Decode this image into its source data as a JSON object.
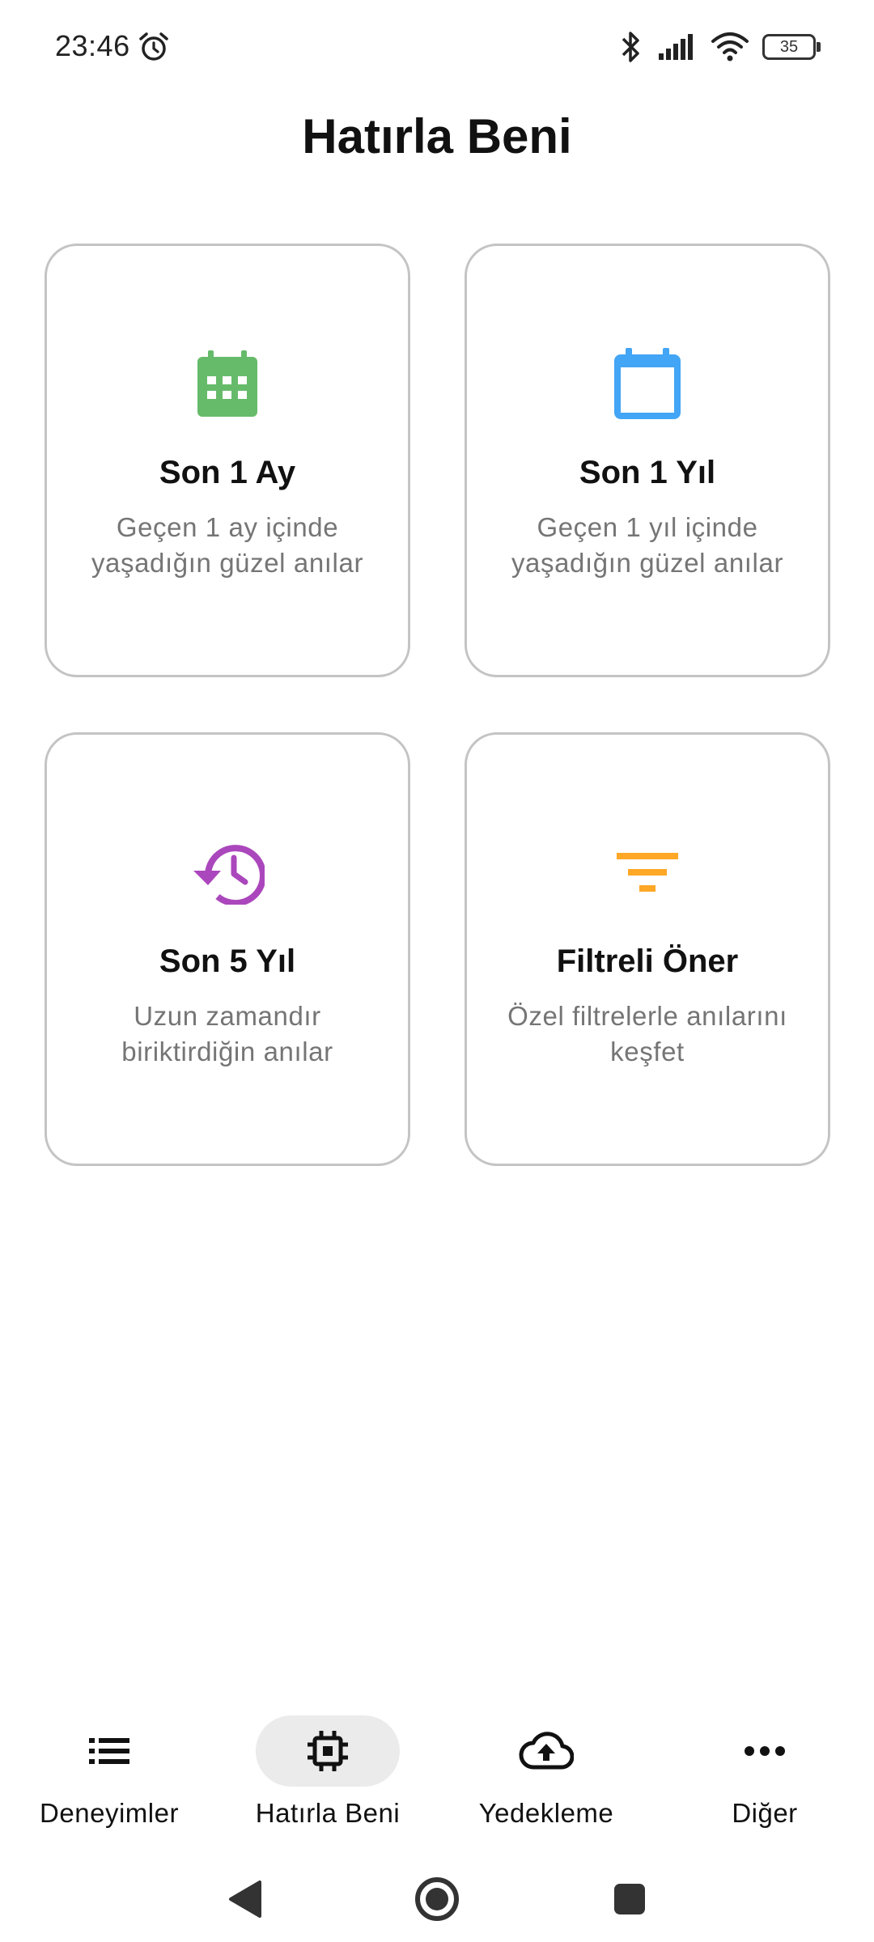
{
  "status_bar": {
    "time": "23:46",
    "alarm_icon": "alarm-icon",
    "bluetooth_icon": "bluetooth-icon",
    "signal_icon": "signal-icon",
    "wifi_icon": "wifi-icon",
    "battery_level": "35"
  },
  "header": {
    "title": "Hatırla Beni"
  },
  "cards": [
    {
      "icon": "calendar-grid-icon",
      "icon_color": "#66BB6A",
      "title": "Son 1 Ay",
      "description": "Geçen 1 ay içinde yaşadığın güzel anılar"
    },
    {
      "icon": "calendar-icon",
      "icon_color": "#42A5F5",
      "title": "Son 1 Yıl",
      "description": "Geçen 1 yıl içinde yaşadığın güzel anılar"
    },
    {
      "icon": "history-icon",
      "icon_color": "#AB47BC",
      "title": "Son 5 Yıl",
      "description": "Uzun zamandır biriktirdiğin anılar"
    },
    {
      "icon": "filter-icon",
      "icon_color": "#FFA726",
      "title": "Filtreli Öner",
      "description": "Özel filtrelerle anılarını keşfet"
    }
  ],
  "bottom_nav": {
    "items": [
      {
        "label": "Deneyimler",
        "icon": "list-icon",
        "active": false
      },
      {
        "label": "Hatırla Beni",
        "icon": "chip-icon",
        "active": true
      },
      {
        "label": "Yedekleme",
        "icon": "cloud-upload-icon",
        "active": false
      },
      {
        "label": "Diğer",
        "icon": "more-horiz-icon",
        "active": false
      }
    ],
    "active_pill_color": "#EBEBEB"
  },
  "system_nav": {
    "back": "back-icon",
    "home": "home-icon",
    "recents": "recents-icon"
  }
}
